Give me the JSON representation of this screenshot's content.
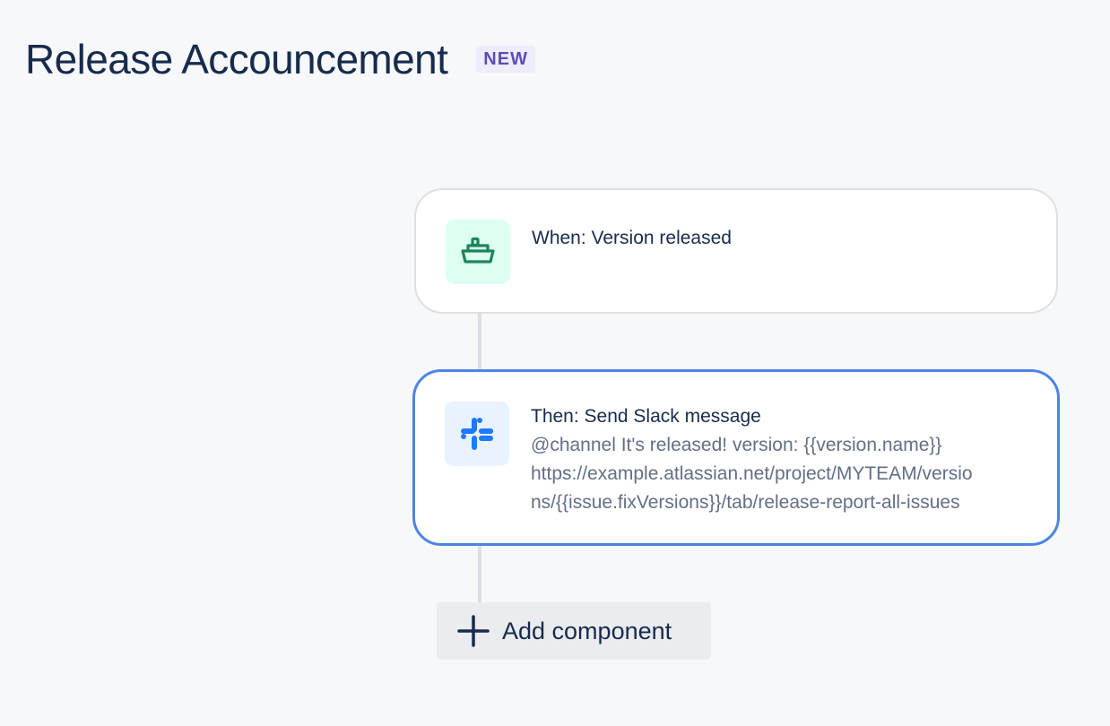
{
  "header": {
    "title": "Release Accouncement",
    "badge": "NEW"
  },
  "trigger": {
    "icon": "ship-icon",
    "title": "When: Version released"
  },
  "action": {
    "icon": "slack-icon",
    "title": "Then: Send Slack message",
    "message_line1": "@channel It's released! version: {{version.name}}",
    "message_line2": "https://example.atlassian.net/project/MYTEAM/versio\nns/{{issue.fixVersions}}/tab/release-report-all-issues"
  },
  "add_component": {
    "icon": "plus-icon",
    "label": "Add component"
  },
  "colors": {
    "background": "#f7f8f9",
    "selected_border": "#4c84e6",
    "trigger_icon": "#1f845a",
    "slack_icon": "#1d7afc",
    "badge_text": "#5e4db2"
  }
}
